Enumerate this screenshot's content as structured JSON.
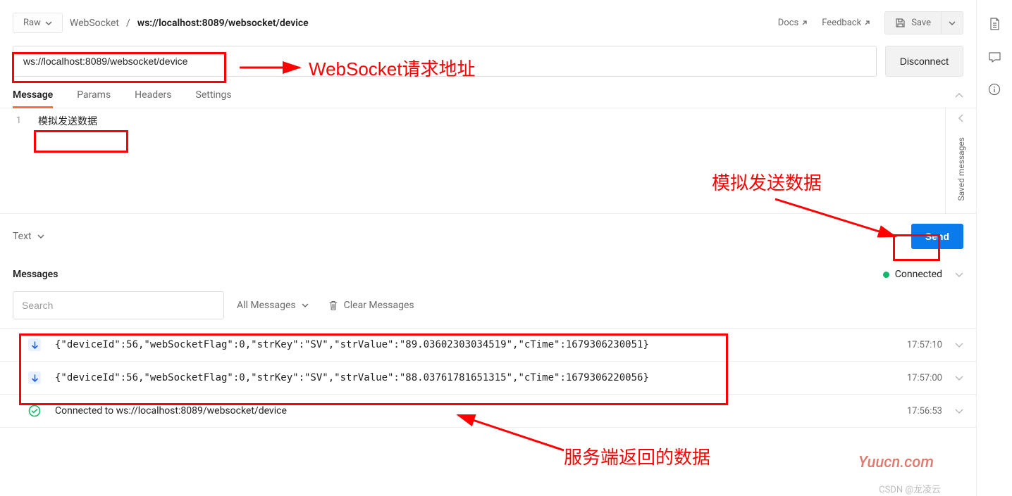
{
  "breadcrumb": {
    "raw_label": "Raw",
    "websocket_label": "WebSocket",
    "path": "ws://localhost:8089/websocket/device"
  },
  "header_links": {
    "docs": "Docs",
    "feedback": "Feedback",
    "save": "Save"
  },
  "url": "ws://localhost:8089/websocket/device",
  "buttons": {
    "disconnect": "Disconnect",
    "send": "Send"
  },
  "tabs": {
    "message": "Message",
    "params": "Params",
    "headers": "Headers",
    "settings": "Settings"
  },
  "editor": {
    "line1_no": "1",
    "line1_text": "模拟发送数据",
    "saved_messages": "Saved messages"
  },
  "body_type": "Text",
  "messages_section": {
    "title": "Messages",
    "status": "Connected",
    "search_placeholder": "Search",
    "filter": "All Messages",
    "clear": "Clear Messages"
  },
  "messages": [
    {
      "type": "down",
      "text": "{\"deviceId\":56,\"webSocketFlag\":0,\"strKey\":\"SV\",\"strValue\":\"89.03602303034519\",\"cTime\":1679306230051}",
      "time": "17:57:10"
    },
    {
      "type": "down",
      "text": "{\"deviceId\":56,\"webSocketFlag\":0,\"strKey\":\"SV\",\"strValue\":\"88.03761781651315\",\"cTime\":1679306220056}",
      "time": "17:57:00"
    },
    {
      "type": "ok",
      "text": "Connected to ws://localhost:8089/websocket/device",
      "time": "17:56:53"
    }
  ],
  "annotations": {
    "url": "WebSocket请求地址",
    "send": "模拟发送数据",
    "response": "服务端返回的数据"
  },
  "watermark": {
    "site": "Yuucn.com",
    "csdn": "CSDN @龙凌云"
  }
}
